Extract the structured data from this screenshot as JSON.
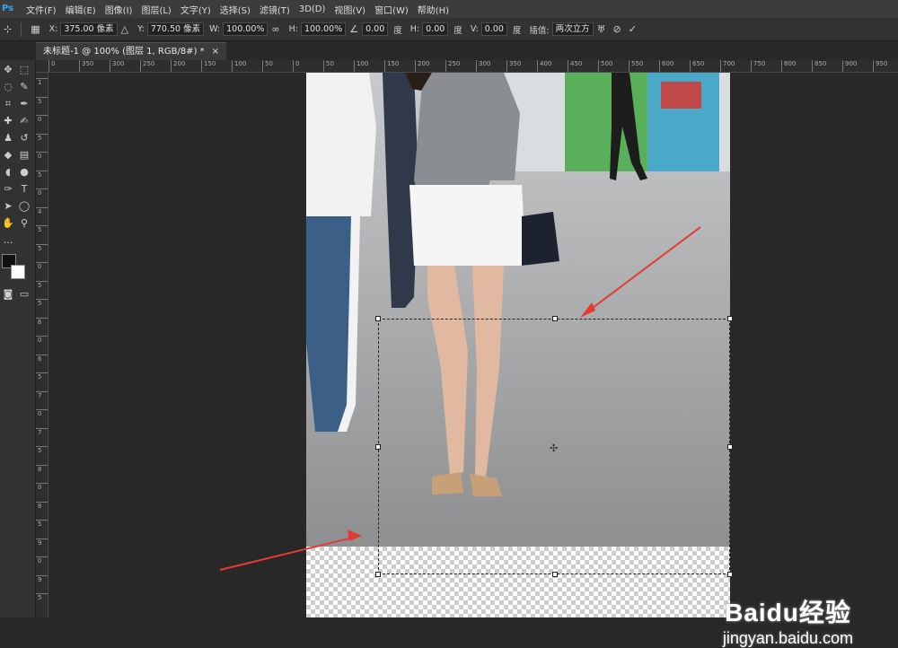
{
  "menubar": {
    "logo": "Ps",
    "items": [
      "文件(F)",
      "编辑(E)",
      "图像(I)",
      "图层(L)",
      "文字(Y)",
      "选择(S)",
      "滤镜(T)",
      "3D(D)",
      "视图(V)",
      "窗口(W)",
      "帮助(H)"
    ]
  },
  "options": {
    "x_label": "X:",
    "x_value": "375.00 像素",
    "y_label": "Y:",
    "y_value": "770.50 像素",
    "w_label": "W:",
    "w_value": "100.00%",
    "h_label": "H:",
    "h_value": "100.00%",
    "angle_value": "0.00",
    "angle_unit": "度",
    "hskew_label": "H:",
    "hskew_value": "0.00",
    "hskew_unit": "度",
    "vskew_label": "V:",
    "vskew_value": "0.00",
    "vskew_unit": "度",
    "interp_label": "插值:",
    "interp_value": "两次立方"
  },
  "tab": {
    "title": "未标题-1 @ 100% (图层 1, RGB/8#) *",
    "close": "×"
  },
  "hruler_labels": [
    "0",
    "350",
    "300",
    "250",
    "200",
    "150",
    "100",
    "50",
    "0",
    "50",
    "100",
    "150",
    "200",
    "250",
    "300",
    "350",
    "400",
    "450",
    "500",
    "550",
    "600",
    "650",
    "700",
    "750",
    "800",
    "850",
    "900",
    "950"
  ],
  "vruler_labels": [
    "1",
    "5",
    "0",
    "5",
    "0",
    "5",
    "0",
    "4",
    "5",
    "5",
    "0",
    "5",
    "5",
    "6",
    "0",
    "6",
    "5",
    "7",
    "0",
    "7",
    "5",
    "8",
    "0",
    "8",
    "5",
    "9",
    "0",
    "9",
    "5"
  ],
  "watermark": {
    "brand": "Baidu经验",
    "url": "jingyan.baidu.com"
  },
  "colors": {
    "menubar": "#3c3c3c",
    "optbar": "#323232",
    "canvas_bg": "#282828",
    "arrow": "#e53935"
  }
}
